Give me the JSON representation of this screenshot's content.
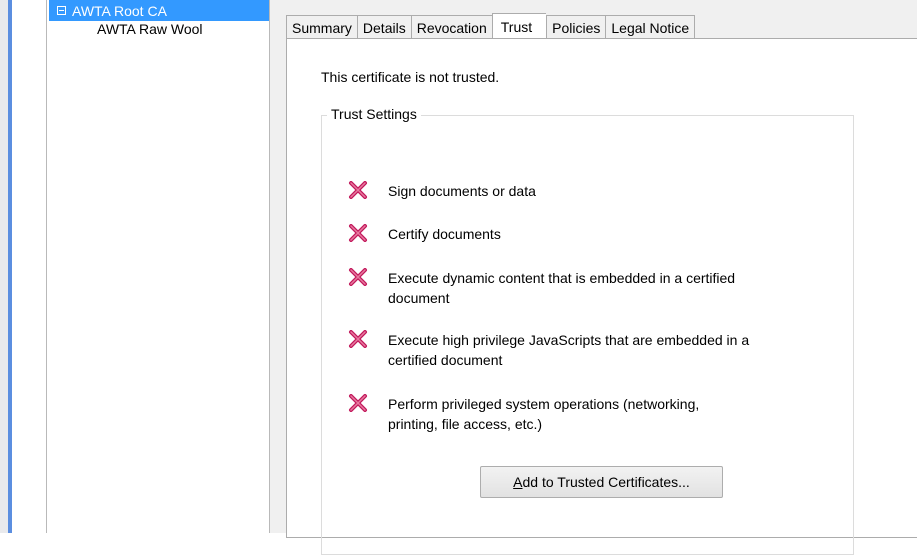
{
  "tree": {
    "root_label": "AWTA Root CA",
    "child_label": "AWTA Raw Wool"
  },
  "tabs": [
    {
      "label": "Summary"
    },
    {
      "label": "Details"
    },
    {
      "label": "Revocation"
    },
    {
      "label": "Trust",
      "active": true
    },
    {
      "label": "Policies"
    },
    {
      "label": "Legal Notice"
    }
  ],
  "trust": {
    "status_text": "This certificate is not trusted.",
    "group_title": "Trust Settings",
    "items": [
      {
        "line1": "Sign documents or data",
        "line2": ""
      },
      {
        "line1": "Certify documents",
        "line2": ""
      },
      {
        "line1": "Execute dynamic content that is embedded in a certified",
        "line2": "document"
      },
      {
        "line1": "Execute high privilege JavaScripts that are embedded in a",
        "line2": "certified document"
      },
      {
        "line1": "Perform privileged system operations (networking,",
        "line2": "printing, file access, etc.)"
      }
    ],
    "add_button": {
      "accel": "A",
      "rest": "dd to Trusted Certificates..."
    }
  },
  "colors": {
    "selection": "#3399ff",
    "x_icon": "#c2185b"
  }
}
